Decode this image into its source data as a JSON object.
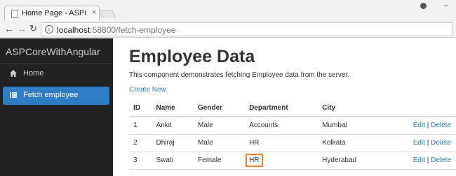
{
  "browser": {
    "tab_title": "Home Page - ASPCoreW",
    "tab_close": "×",
    "url_host": "localhost",
    "url_rest": ":58800/fetch-employee",
    "window_controls": [
      "–"
    ]
  },
  "sidebar": {
    "brand": "ASPCoreWithAngular",
    "items": [
      {
        "label": "Home",
        "icon": "home-icon",
        "active": false
      },
      {
        "label": "Fetch employee",
        "icon": "list-icon",
        "active": true
      }
    ]
  },
  "main": {
    "title": "Employee Data",
    "description": "This component demonstrates fetching Employee data from the server.",
    "create_link": "Create New"
  },
  "table": {
    "headers": [
      "ID",
      "Name",
      "Gender",
      "Department",
      "City"
    ],
    "rows": [
      {
        "id": "1",
        "name": "Ankit",
        "gender": "Male",
        "department": "Accounts",
        "city": "Mumbai"
      },
      {
        "id": "2",
        "name": "Dhiraj",
        "gender": "Male",
        "department": "HR",
        "city": "Kolkata"
      },
      {
        "id": "3",
        "name": "Swati",
        "gender": "Female",
        "department": "HR",
        "city": "Hyderabad"
      }
    ],
    "edit_label": "Edit",
    "separator": "|",
    "delete_label": "Delete"
  },
  "colors": {
    "sidebar_bg": "#222222",
    "active_nav": "#2f7dc4",
    "link": "#337ab7",
    "highlight_border": "#f0852b"
  }
}
